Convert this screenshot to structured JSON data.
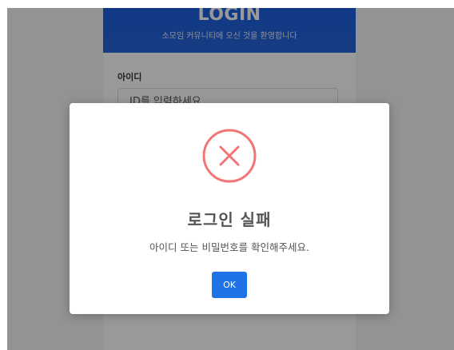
{
  "login": {
    "title": "LOGIN",
    "subtitle": "소모임 커뮤니티에 오신 것을 환영합니다",
    "id_label": "아이디",
    "id_placeholder": "ID를 입력하세요"
  },
  "modal": {
    "icon": "error-x-circle-icon",
    "title": "로그인 실패",
    "message": "아이디 또는 비밀번호를 확인해주세요.",
    "ok_label": "OK"
  },
  "colors": {
    "header_blue": "#2565d9",
    "error_red": "#f27474",
    "button_blue": "#1f73e6"
  }
}
